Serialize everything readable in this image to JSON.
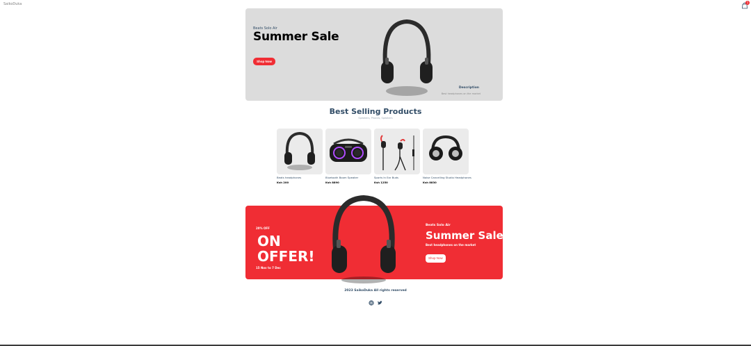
{
  "navbar": {
    "logo": "SaikoDuka",
    "cart_count": "1",
    "cart_icon": "shopping-bag-icon"
  },
  "hero": {
    "small_text": "Beats Solo Air",
    "mid_text": "Summer Sale",
    "button": "Shop Now",
    "desc_title": "Description",
    "desc_text": "Best headphones on the market"
  },
  "products_heading": {
    "title": "Best Selling Products",
    "subtitle": "Speakers, Phones, Speakers"
  },
  "products": [
    {
      "name": "Beats headphones",
      "price": "Ksh 200"
    },
    {
      "name": "Bluetooth Boom Speaker",
      "price": "Ksh 8890"
    },
    {
      "name": "Sports In Ear Buds",
      "price": "Ksh 1250"
    },
    {
      "name": "Noise Cancelling Studio Headphones",
      "price": "Ksh 8830"
    }
  ],
  "footer_banner": {
    "discount": "20% OFF",
    "large1": "ON",
    "large2": "OFFER!",
    "time_range": "15 Nov to 7 Dec",
    "small_text": "Beats Solo Air",
    "mid_text": "Summer Sale",
    "desc": "Best headphones on the market",
    "button": "Shop Now"
  },
  "footer": {
    "copyright": "2023 SaikoDuka All rights reserved",
    "icons": [
      "instagram-icon",
      "twitter-icon"
    ]
  },
  "colors": {
    "accent": "#f02d34",
    "heading": "#324d67",
    "hero_bg": "#dcdcdc",
    "card_bg": "#ebebeb"
  }
}
